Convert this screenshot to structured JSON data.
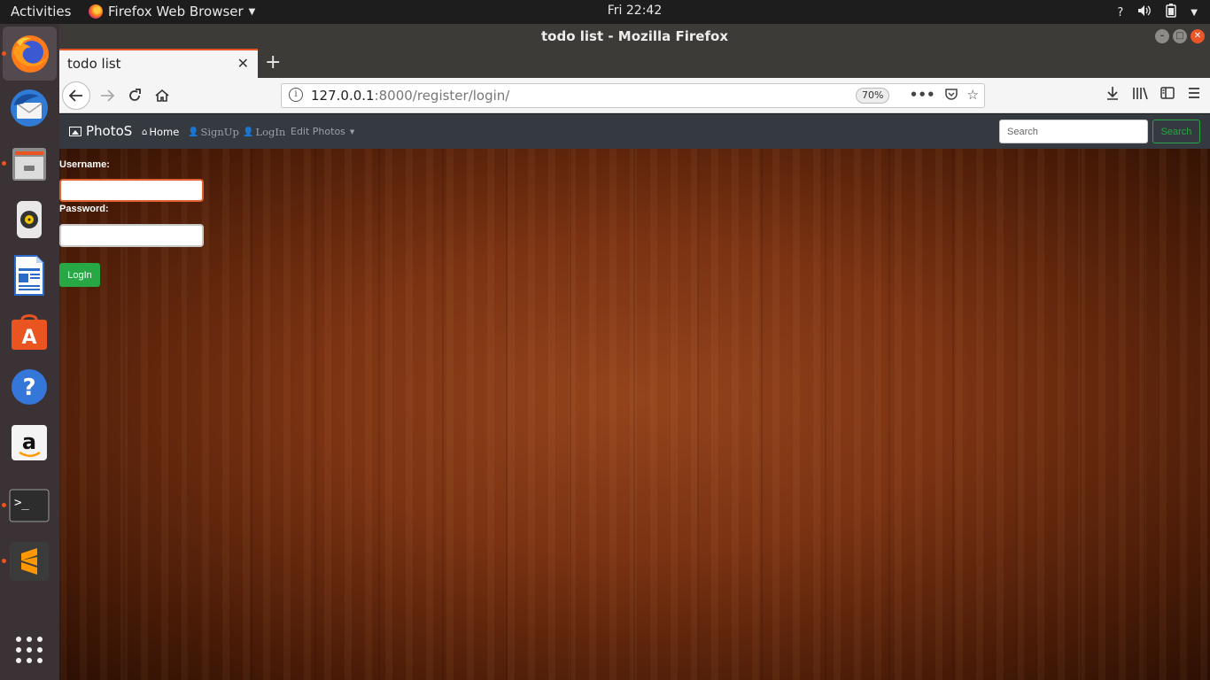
{
  "topbar": {
    "activities": "Activities",
    "app_name": "Firefox Web Browser",
    "clock": "Fri 22:42",
    "tray_help": "?"
  },
  "dock": {
    "items": [
      "firefox-icon",
      "thunderbird-icon",
      "files-icon",
      "rhythmbox-icon",
      "writer-icon",
      "software-center-icon",
      "help-icon",
      "amazon-icon",
      "terminal-icon",
      "sublime-text-icon",
      "show-apps-icon"
    ]
  },
  "browser": {
    "window_title": "todo list - Mozilla Firefox",
    "tab_title": "todo list",
    "url_host": "127.0.0.1",
    "url_path": ":8000/register/login/",
    "zoom": "70%"
  },
  "site": {
    "brand": "PhotoS",
    "nav": {
      "home": "Home",
      "signup": "SignUp",
      "login": "LogIn",
      "edit_photos": "Edit Photos"
    },
    "search_placeholder": "Search",
    "search_button": "Search"
  },
  "form": {
    "username_label": "Username:",
    "password_label": "Password:",
    "username_value": "",
    "password_value": "",
    "submit": "LogIn"
  },
  "colors": {
    "accent_green": "#28a745",
    "ubuntu_orange": "#e95420",
    "nav_bg": "#343a40"
  }
}
